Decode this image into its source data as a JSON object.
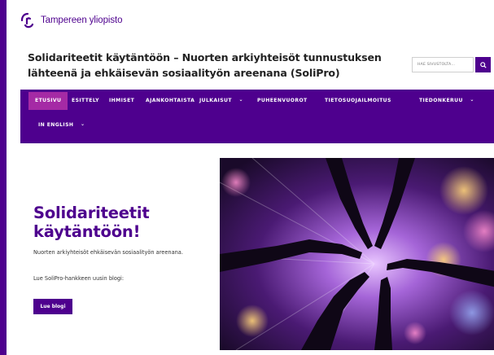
{
  "header": {
    "logo_text": "Tampereen yliopisto",
    "site_title": "Solidariteetit käytäntöön – Nuorten arkiyhteisöt tunnustuksen lähteenä ja ehkäisevän sosiaalityön areenana (SoliPro)"
  },
  "search": {
    "placeholder": "HAE SIVUSTOLTA…",
    "icon": "search-icon"
  },
  "nav": {
    "items": [
      {
        "label": "ETUSIVU",
        "active": true
      },
      {
        "label": "ESITTELY"
      },
      {
        "label": "IHMISET"
      },
      {
        "label": "AJANKOHTAISTA"
      },
      {
        "label": "JULKAISUT",
        "dropdown": true
      },
      {
        "label": "PUHEENVUOROT"
      },
      {
        "label": "TIETOSUOJAILMOITUS"
      },
      {
        "label": "TIEDONKERUU",
        "dropdown": true
      },
      {
        "label": "IN ENGLISH",
        "dropdown": true
      }
    ]
  },
  "hero": {
    "title": "Solidariteetit käytäntöön!",
    "subtitle": "Nuorten arkiyhteisöt ehkäisevän sosiaalityön areenana.",
    "blog_intro": "Lue SoliPro-hankkeen uusin blogi:",
    "button_label": "Lue blogi"
  },
  "colors": {
    "brand": "#4e008e",
    "active_nav": "#a52aa5",
    "frame": "#4e008e"
  }
}
